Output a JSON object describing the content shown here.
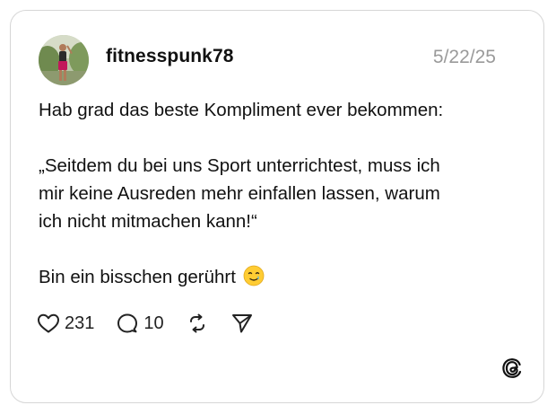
{
  "post": {
    "username": "fitnesspunk78",
    "date": "5/22/25",
    "avatar_icon": "user-avatar-photo",
    "text": {
      "line1": "Hab grad das beste Kompliment ever bekommen:",
      "quote_line1": "„Seitdem du bei uns Sport unterrichtest, muss ich",
      "quote_line2": "mir keine Ausreden mehr einfallen lassen, warum",
      "quote_line3": "ich nicht mitmachen kann!“",
      "closing": "Bin ein bisschen gerührt",
      "closing_emoji": "smiling-face-with-tear-emoji"
    }
  },
  "actions": {
    "likes": "231",
    "replies": "10",
    "like_icon": "heart-icon",
    "reply_icon": "comment-icon",
    "repost_icon": "repost-icon",
    "share_icon": "send-icon"
  },
  "branding": {
    "logo_icon": "threads-logo-icon"
  },
  "colors": {
    "card_border": "#d6d6d6",
    "date_text": "#9a9a9a",
    "text": "#111111"
  }
}
